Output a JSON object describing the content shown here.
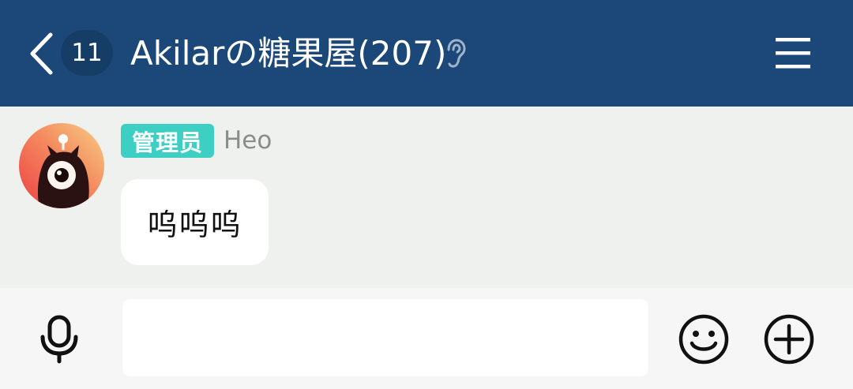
{
  "header": {
    "unread_count": "11",
    "title": "Akilarの糖果屋(207)",
    "back_icon": "chevron-left-icon",
    "ear_icon": "ear-icon",
    "menu_icon": "hamburger-menu-icon",
    "background_color": "#1b4878"
  },
  "messages": [
    {
      "role_badge": "管理员",
      "sender": "Heo",
      "text": "呜呜呜",
      "avatar": "cartoon-one-eyed-monster-avatar"
    }
  ],
  "input_bar": {
    "value": "",
    "placeholder": "",
    "mic_icon": "microphone-icon",
    "emoji_icon": "smiley-icon",
    "plus_icon": "plus-circle-icon"
  },
  "colors": {
    "header_bg": "#1b4878",
    "badge_bg": "#163d66",
    "role_badge_bg": "#3dcfc4",
    "chat_bg": "#eef1ee",
    "input_bar_bg": "#f6f6f6"
  }
}
